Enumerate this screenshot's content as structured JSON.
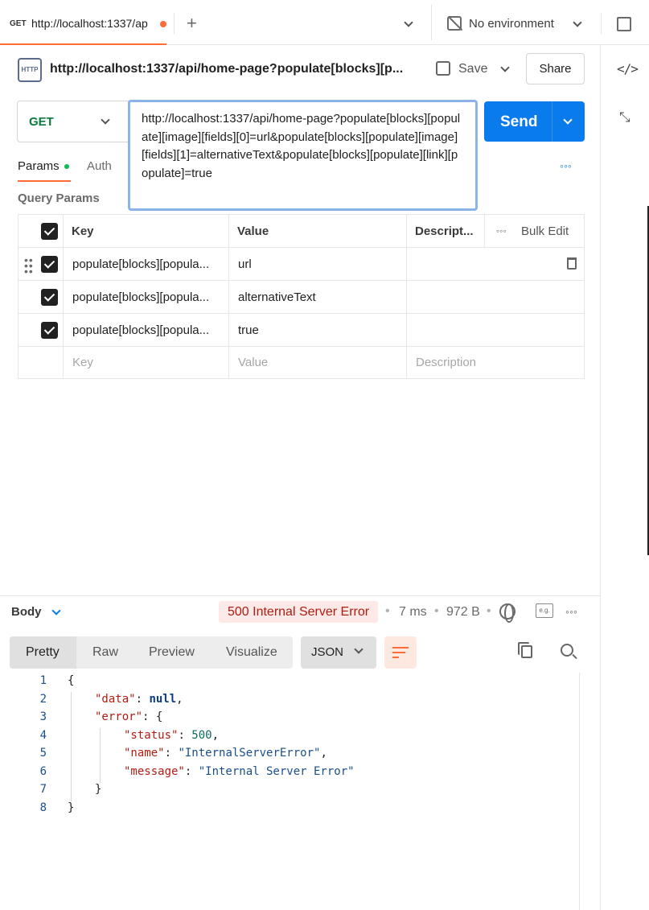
{
  "tab": {
    "method": "GET",
    "url": "http://localhost:1337/ap"
  },
  "environment": {
    "label": "No environment"
  },
  "request": {
    "icon_label": "HTTP",
    "title": "http://localhost:1337/api/home-page?populate[blocks][p...",
    "save_label": "Save",
    "share_label": "Share",
    "method": "GET",
    "url": "http://localhost:1337/api/home-page?populate[blocks][populate][image][fields][0]=url&populate[blocks][populate][image][fields][1]=alternativeText&populate[blocks][populate][link][populate]=true",
    "send_label": "Send"
  },
  "request_tabs": {
    "params": "Params",
    "auth": "Auth",
    "more": "◦◦◦"
  },
  "query_params": {
    "heading": "Query Params",
    "columns": {
      "key": "Key",
      "value": "Value",
      "description": "Descript...",
      "bulk_edit": "Bulk Edit"
    },
    "rows": [
      {
        "key": "populate[blocks][popula...",
        "value": "url"
      },
      {
        "key": "populate[blocks][popula...",
        "value": "alternativeText"
      },
      {
        "key": "populate[blocks][popula...",
        "value": "true"
      }
    ],
    "placeholders": {
      "key": "Key",
      "value": "Value",
      "description": "Description"
    }
  },
  "response": {
    "body_label": "Body",
    "status": "500 Internal Server Error",
    "time": "7 ms",
    "size": "972 B",
    "eg_label": "e.g.",
    "view_tabs": [
      "Pretty",
      "Raw",
      "Preview",
      "Visualize"
    ],
    "format": "JSON",
    "line_numbers": [
      "1",
      "2",
      "3",
      "4",
      "5",
      "6",
      "7",
      "8"
    ],
    "json": {
      "open": "{",
      "data_key": "\"data\"",
      "data_value": "null",
      "error_key": "\"error\"",
      "status_key": "\"status\"",
      "status_value": "500",
      "name_key": "\"name\"",
      "name_value": "\"InternalServerError\"",
      "message_key": "\"message\"",
      "message_value": "\"Internal Server Error\"",
      "close": "}"
    }
  },
  "colors": {
    "accent": "#ff6c37",
    "send": "#097bed",
    "method_get": "#0b7a3e",
    "status_error_bg": "#fde9e7",
    "status_error_text": "#b01c10"
  }
}
